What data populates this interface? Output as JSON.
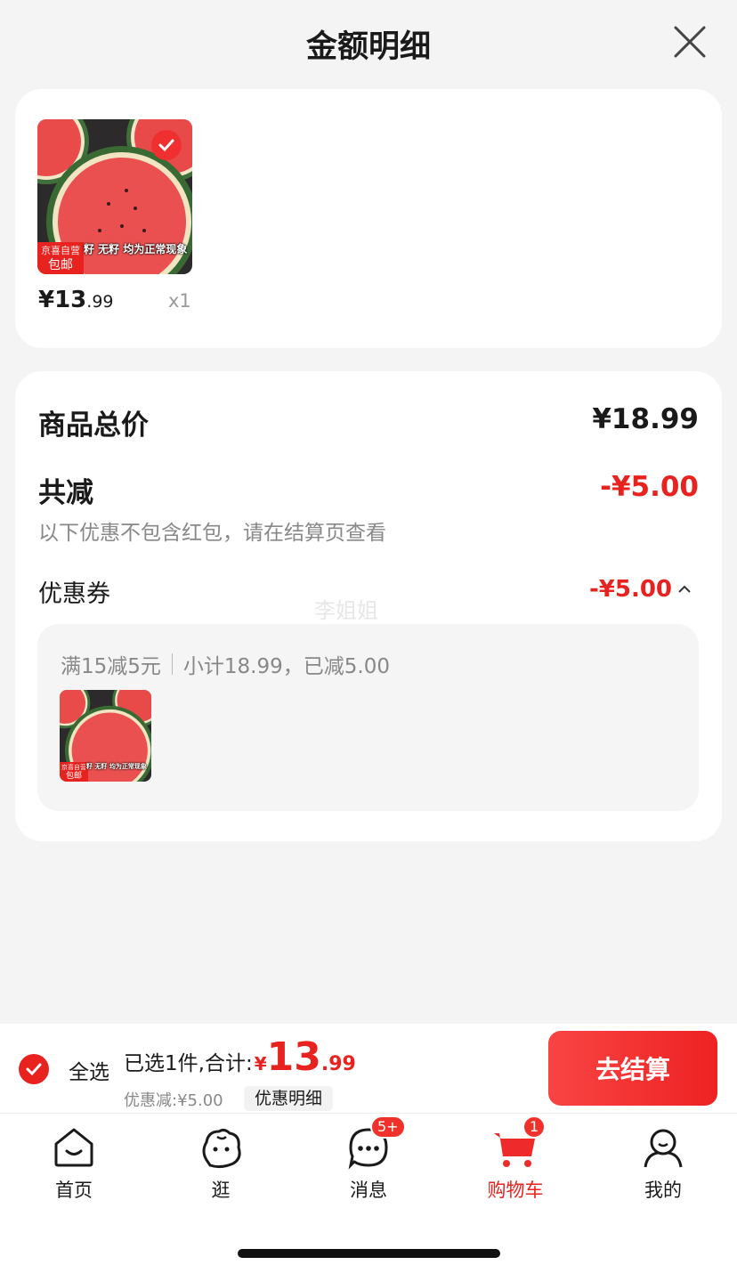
{
  "header": {
    "title": "金额明细"
  },
  "product": {
    "image_tag_line1": "京喜自营",
    "image_tag_line2": "包邮",
    "image_caption": "籽 无籽 均为正常现象",
    "price_int": "¥13",
    "price_dec": ".99",
    "quantity": "x1"
  },
  "summary": {
    "total_label": "商品总价",
    "total_value": "¥18.99",
    "reduce_label": "共减",
    "reduce_value": "-¥5.00",
    "reduce_note": "以下优惠不包含红包，请在结算页查看",
    "coupon_label": "优惠券",
    "coupon_value": "-¥5.00",
    "watermark": "李姐姐",
    "coupon_rule": "满15减5元",
    "coupon_detail": "小计18.99，已减5.00"
  },
  "checkout": {
    "select_all": "全选",
    "selected_text": "已选1件,合计:",
    "total_yen": "¥",
    "total_int": "13",
    "total_dec": ".99",
    "discount_text": "优惠减:¥5.00",
    "detail_button": "优惠明细",
    "checkout_button": "去结算"
  },
  "tabbar": {
    "items": [
      {
        "label": "首页",
        "icon": "home-icon"
      },
      {
        "label": "逛",
        "icon": "browse-icon"
      },
      {
        "label": "消息",
        "icon": "message-icon",
        "badge": "5+"
      },
      {
        "label": "购物车",
        "icon": "cart-icon",
        "badge": "1",
        "active": true
      },
      {
        "label": "我的",
        "icon": "profile-icon"
      }
    ]
  },
  "colors": {
    "accent": "#e8221e",
    "background": "#f4f4f4"
  }
}
